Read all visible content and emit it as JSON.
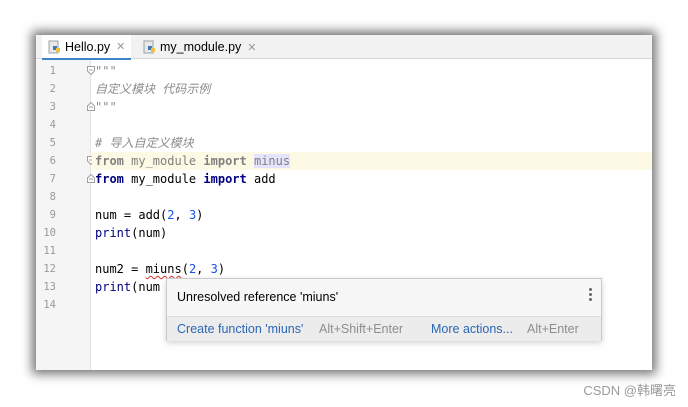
{
  "tabs": [
    {
      "label": "Hello.py",
      "active": true
    },
    {
      "label": "my_module.py",
      "active": false
    }
  ],
  "close_glyph": "✕",
  "line_numbers": [
    "1",
    "2",
    "3",
    "4",
    "5",
    "6",
    "7",
    "8",
    "9",
    "10",
    "11",
    "12",
    "13",
    "14"
  ],
  "code": {
    "l1": "\"\"\"",
    "l2": "自定义模块 代码示例",
    "l3": "\"\"\"",
    "l5": "# 导入自定义模块",
    "l6_kw1": "from",
    "l6_mod": " my_module ",
    "l6_kw2": "import",
    "l6_name": "minus",
    "l7_kw1": "from",
    "l7_mod": " my_module ",
    "l7_kw2": "import",
    "l7_name": " add",
    "l9_a": "num = add(",
    "l9_n1": "2",
    "l9_b": ", ",
    "l9_n2": "3",
    "l9_c": ")",
    "l10_fn": "print",
    "l10_rest": "(num)",
    "l12_a": "num2 = ",
    "l12_err": "miuns",
    "l12_b": "(",
    "l12_n1": "2",
    "l12_c": ", ",
    "l12_n2": "3",
    "l12_d": ")",
    "l13_fn": "print",
    "l13_rest": "(num"
  },
  "popup": {
    "message": "Unresolved reference 'miuns'",
    "action1": "Create function 'miuns'",
    "action1_shortcut": "Alt+Shift+Enter",
    "action2": "More actions...",
    "action2_shortcut": "Alt+Enter"
  },
  "watermark": "CSDN @韩曙亮",
  "colors": {
    "keyword": "#000080",
    "comment": "#8c8c8c",
    "number": "#1750eb",
    "link": "#2b66b5",
    "error_underline": "#e03030",
    "current_line": "#fcfae4"
  }
}
